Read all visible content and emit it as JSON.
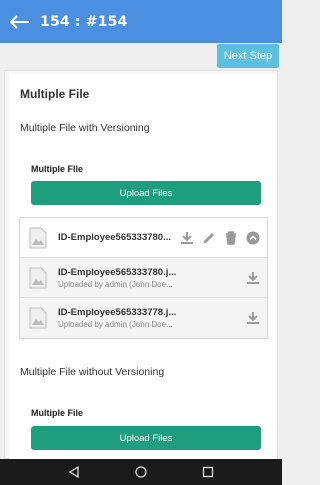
{
  "header": {
    "title": "154 : #154"
  },
  "toolbar": {
    "next_step_label": "Next Step"
  },
  "section": {
    "title": "Multiple File"
  },
  "versioning": {
    "subheading": "Multiple File with Versioning",
    "field_label": "Multiple FIle",
    "upload_label": "Upload Files",
    "files": [
      {
        "name": "ID-Employee565333780..."
      },
      {
        "name": "ID-Employee565333780.j...",
        "meta": "Uploaded by admin (John Doe..."
      },
      {
        "name": "ID-Employee565333778.j...",
        "meta": "Uploaded by admin (John Doe..."
      }
    ]
  },
  "no_versioning": {
    "subheading": "Multiple File without Versioning",
    "field_label": "Multiple File",
    "upload_label": "Upload Files"
  },
  "colors": {
    "appbar": "#4a8fe0",
    "next_button": "#5bbfe0",
    "upload_button": "#1e9e7d"
  }
}
